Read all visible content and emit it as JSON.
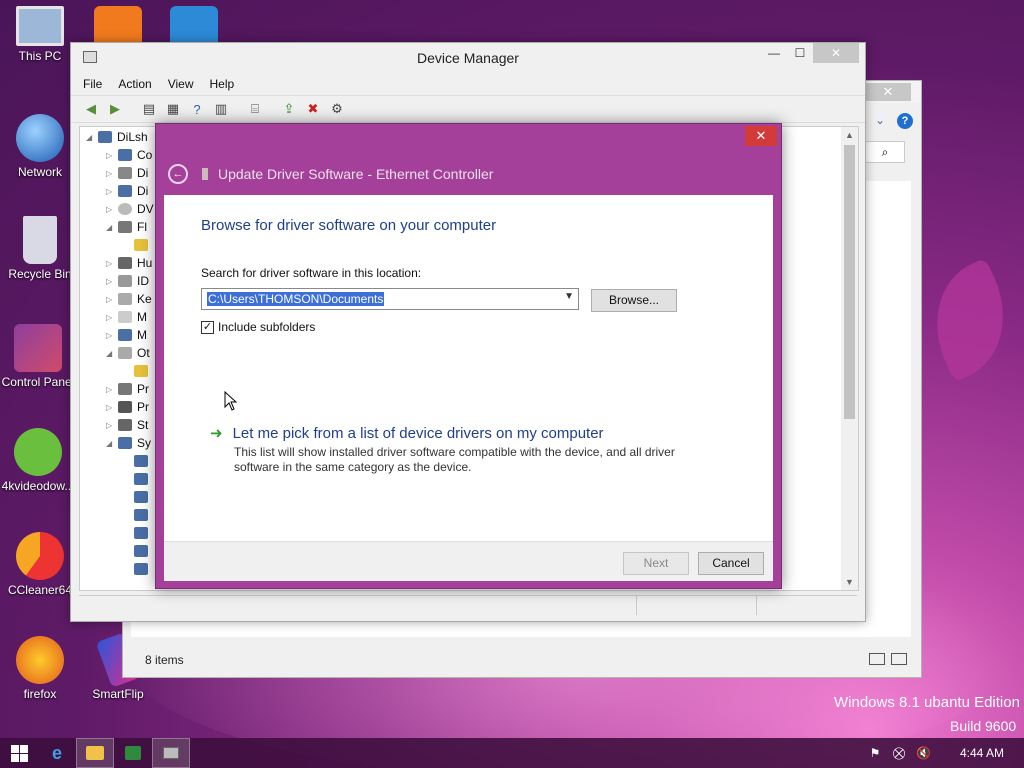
{
  "desktop": {
    "icons": [
      {
        "label": "This PC"
      },
      {
        "label": "Network"
      },
      {
        "label": "Recycle Bin"
      },
      {
        "label": "Control Panel"
      },
      {
        "label": "4kvideodow..."
      },
      {
        "label": "CCleaner64"
      },
      {
        "label": "firefox"
      },
      {
        "label": "SmartFlip"
      }
    ],
    "edition": "Windows 8.1 ubantu Edition",
    "build": "Build 9600"
  },
  "explorer_bg": {
    "status": "8 items"
  },
  "devmgr": {
    "title": "Device Manager",
    "menu": [
      "File",
      "Action",
      "View",
      "Help"
    ],
    "tree_root": "DiLsh",
    "tree_items": [
      "Co",
      "Di",
      "Di",
      "DV",
      "Fl",
      "",
      "Hu",
      "ID",
      "Ke",
      "M",
      "M",
      "Ot",
      "",
      "Pr",
      "Pr",
      "St",
      "Sy"
    ]
  },
  "dialog": {
    "title": "Update Driver Software - Ethernet Controller",
    "heading": "Browse for driver software on your computer",
    "search_label": "Search for driver software in this location:",
    "path_value": "C:\\Users\\THOMSON\\Documents",
    "browse_label": "Browse...",
    "include_subfolders_label": "Include subfolders",
    "include_subfolders_checked": true,
    "pick_link": "Let me pick from a list of device drivers on my computer",
    "pick_desc": "This list will show installed driver software compatible with the device, and all driver software in the same category as the device.",
    "next_label": "Next",
    "cancel_label": "Cancel"
  },
  "taskbar": {
    "time": "4:44 AM"
  },
  "colors": {
    "dialog_frame": "#a4409a",
    "heading_blue": "#1e3f8a",
    "selection_blue": "#3d6fd8",
    "close_red": "#d33b3b"
  }
}
